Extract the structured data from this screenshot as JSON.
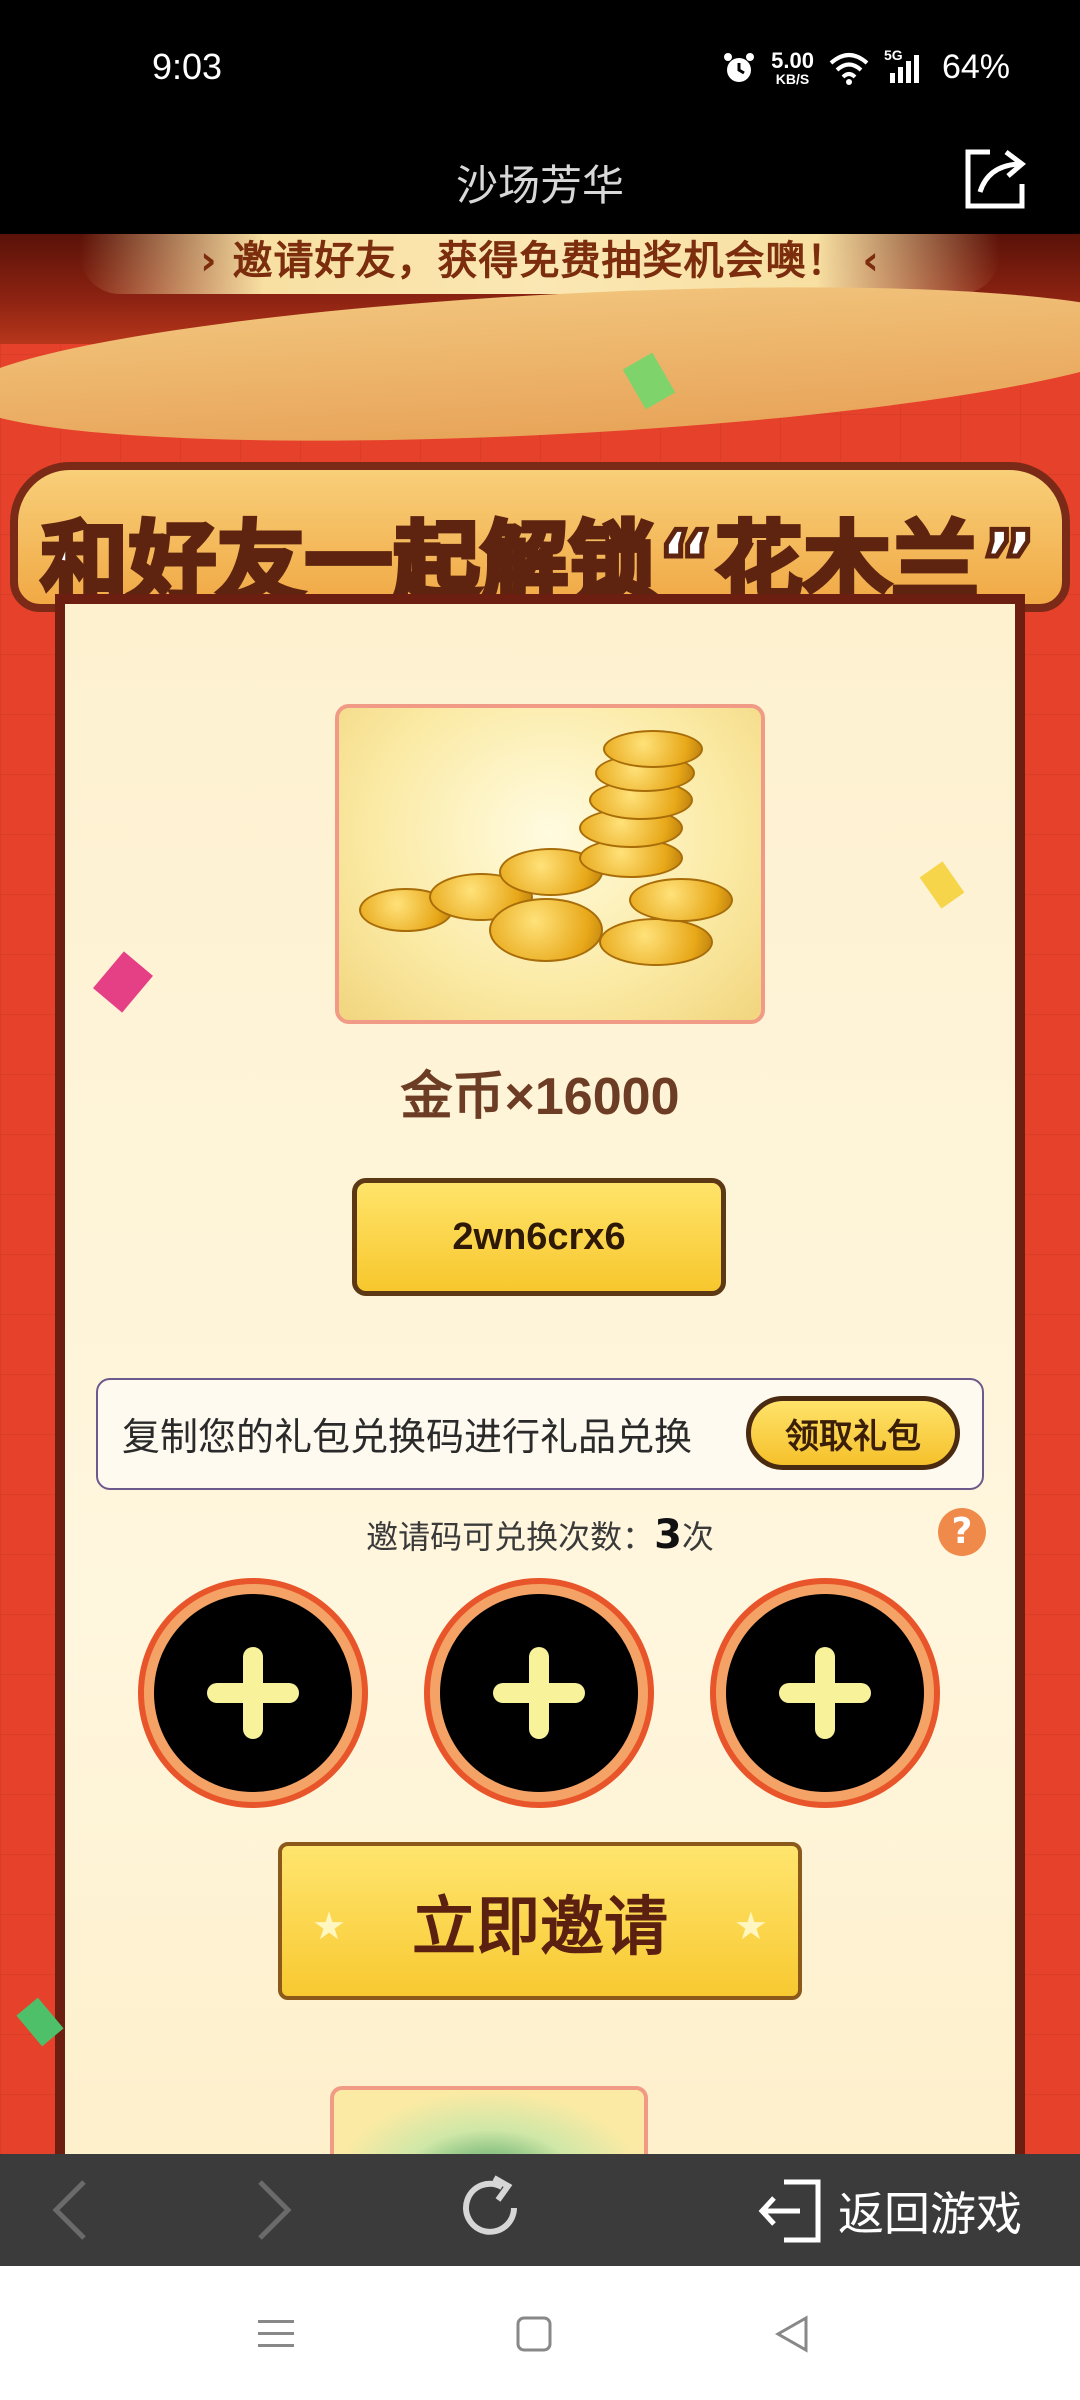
{
  "status_bar": {
    "time": "9:03",
    "speed_value": "5.00",
    "speed_unit": "KB/S",
    "network": "5G",
    "battery": "64%"
  },
  "title_bar": {
    "title": "沙场芳华",
    "share_icon": "share-icon"
  },
  "banner": {
    "text": "› 邀请好友，获得免费抽奖机会噢！ ‹"
  },
  "heading": {
    "text": "和好友一起解锁“花木兰”"
  },
  "reward": {
    "label": "金币×16000",
    "code": "2wn6crx6"
  },
  "redeem": {
    "text": "复制您的礼包兑换码进行礼品兑换",
    "claim_label": "领取礼包"
  },
  "invite": {
    "count_prefix": "邀请码可兑换次数：",
    "count": "3",
    "count_suffix": "次",
    "help_label": "?",
    "button_label": "立即邀请"
  },
  "browser_bar": {
    "back_icon": "chevron-left-icon",
    "forward_icon": "chevron-right-icon",
    "refresh_icon": "refresh-icon",
    "return_label": "返回游戏"
  },
  "nav_bar": {
    "menu_icon": "menu-icon",
    "home_icon": "home-square-icon",
    "back_icon": "back-triangle-icon"
  },
  "colors": {
    "page_red": "#e6412a",
    "card_cream": "#fdf1d0",
    "button_yellow": "#f8c931",
    "slot_orange": "#e8552a",
    "plus_yellow": "#f8f29a"
  }
}
